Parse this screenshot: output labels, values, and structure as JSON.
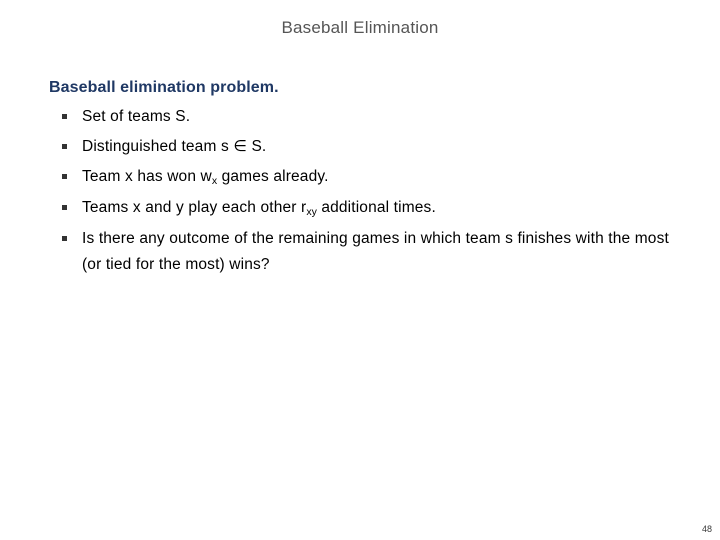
{
  "slide": {
    "title": "Baseball Elimination",
    "page_number": "48",
    "title_color": "#555555",
    "heading_color": "#1F3864",
    "body_color": "#000000",
    "background_color": "#ffffff"
  },
  "content": {
    "lead_heading": "Baseball elimination problem.",
    "bullets": [
      {
        "parts": [
          {
            "type": "text",
            "value": "Set of teams S."
          }
        ],
        "plain": "Set of teams S."
      },
      {
        "parts": [
          {
            "type": "text",
            "value": "Distinguished team s ∈ S."
          }
        ],
        "plain": "Distinguished team s ∈ S."
      },
      {
        "parts": [
          {
            "type": "text",
            "value": "Team x has won w"
          },
          {
            "type": "sub",
            "value": "x"
          },
          {
            "type": "text",
            "value": " games already."
          }
        ],
        "plain": "Team x has won wx games already."
      },
      {
        "parts": [
          {
            "type": "text",
            "value": "Teams x and y play each other r"
          },
          {
            "type": "sub",
            "value": "xy"
          },
          {
            "type": "text",
            "value": " additional times."
          }
        ],
        "plain": "Teams x and y play each other rxy additional times."
      },
      {
        "parts": [
          {
            "type": "text",
            "value": "Is there any outcome of the remaining games in which team s finishes with the most (or tied for the most) wins?"
          }
        ],
        "plain": "Is there any outcome of the remaining games in which team s finishes with the most (or tied for the most) wins?"
      }
    ]
  }
}
